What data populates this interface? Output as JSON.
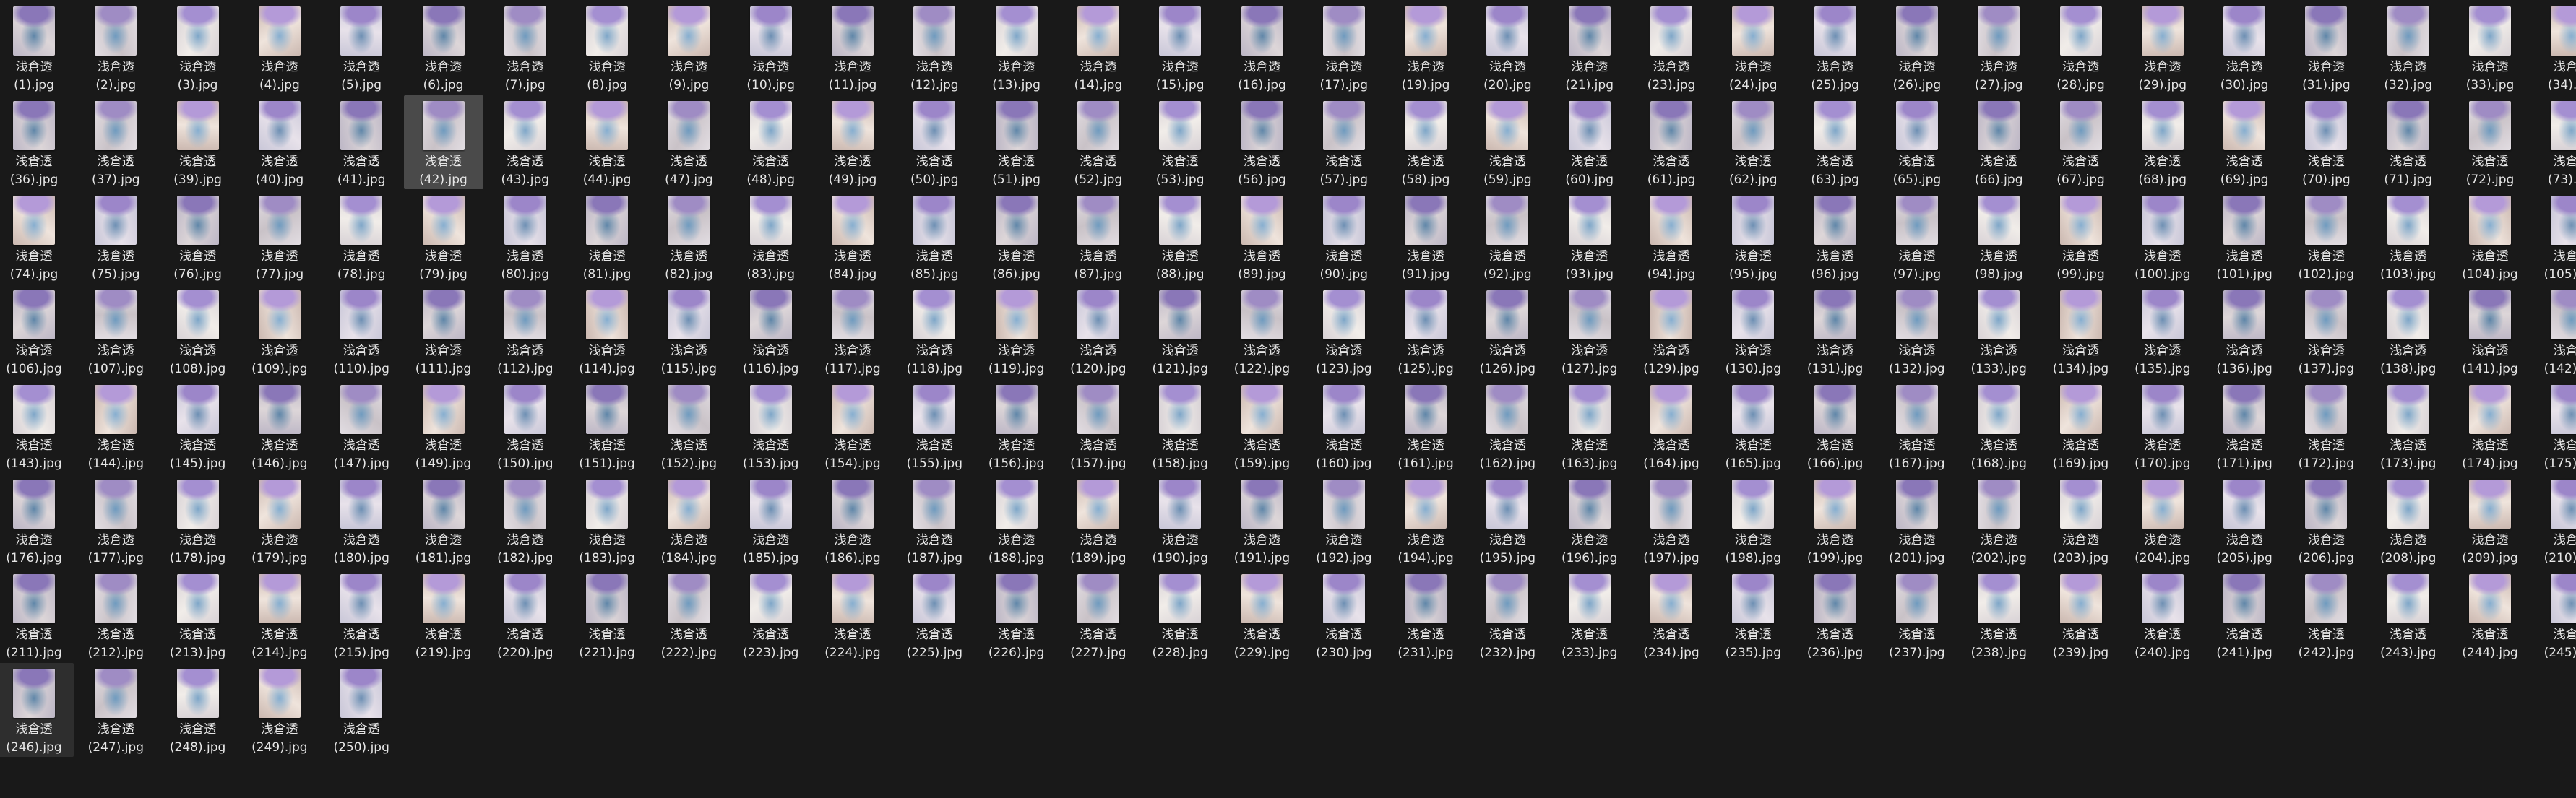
{
  "explorer": {
    "view": "large-icons",
    "file_base_name": "浅倉透",
    "file_extension": ".jpg",
    "file_numbers": [
      1,
      2,
      3,
      4,
      5,
      6,
      7,
      8,
      9,
      10,
      11,
      12,
      13,
      14,
      15,
      16,
      17,
      19,
      20,
      21,
      23,
      24,
      25,
      26,
      27,
      28,
      29,
      30,
      31,
      32,
      33,
      34,
      36,
      37,
      39,
      40,
      41,
      42,
      43,
      44,
      47,
      48,
      49,
      50,
      51,
      52,
      53,
      56,
      57,
      58,
      59,
      60,
      61,
      62,
      63,
      65,
      66,
      67,
      68,
      69,
      70,
      71,
      72,
      73,
      74,
      75,
      76,
      77,
      78,
      79,
      80,
      81,
      82,
      83,
      84,
      85,
      86,
      87,
      88,
      89,
      90,
      91,
      92,
      93,
      94,
      95,
      96,
      97,
      98,
      99,
      100,
      101,
      102,
      103,
      104,
      105,
      106,
      107,
      108,
      109,
      110,
      111,
      112,
      114,
      115,
      116,
      117,
      118,
      119,
      120,
      121,
      122,
      123,
      125,
      126,
      127,
      129,
      130,
      131,
      132,
      133,
      134,
      135,
      136,
      137,
      138,
      141,
      142,
      143,
      144,
      145,
      146,
      147,
      149,
      150,
      151,
      152,
      153,
      154,
      155,
      156,
      157,
      158,
      159,
      160,
      161,
      162,
      163,
      164,
      165,
      166,
      167,
      168,
      169,
      170,
      171,
      172,
      173,
      174,
      175,
      176,
      177,
      178,
      179,
      180,
      181,
      182,
      183,
      184,
      185,
      186,
      187,
      188,
      189,
      190,
      191,
      192,
      194,
      195,
      196,
      197,
      198,
      199,
      201,
      202,
      203,
      204,
      205,
      206,
      208,
      209,
      210,
      211,
      212,
      213,
      214,
      215,
      219,
      220,
      221,
      222,
      223,
      224,
      225,
      226,
      227,
      228,
      229,
      230,
      231,
      232,
      233,
      234,
      235,
      236,
      237,
      238,
      239,
      240,
      241,
      242,
      243,
      244,
      245,
      246,
      247,
      248,
      249,
      250
    ],
    "selected_file_number": 42,
    "hovered_file_number": 246,
    "colors": {
      "background": "#191919",
      "label_text": "#e6e6e6",
      "selected_background": "#4a4a4a",
      "hover_background": "#2e2e2e"
    }
  }
}
